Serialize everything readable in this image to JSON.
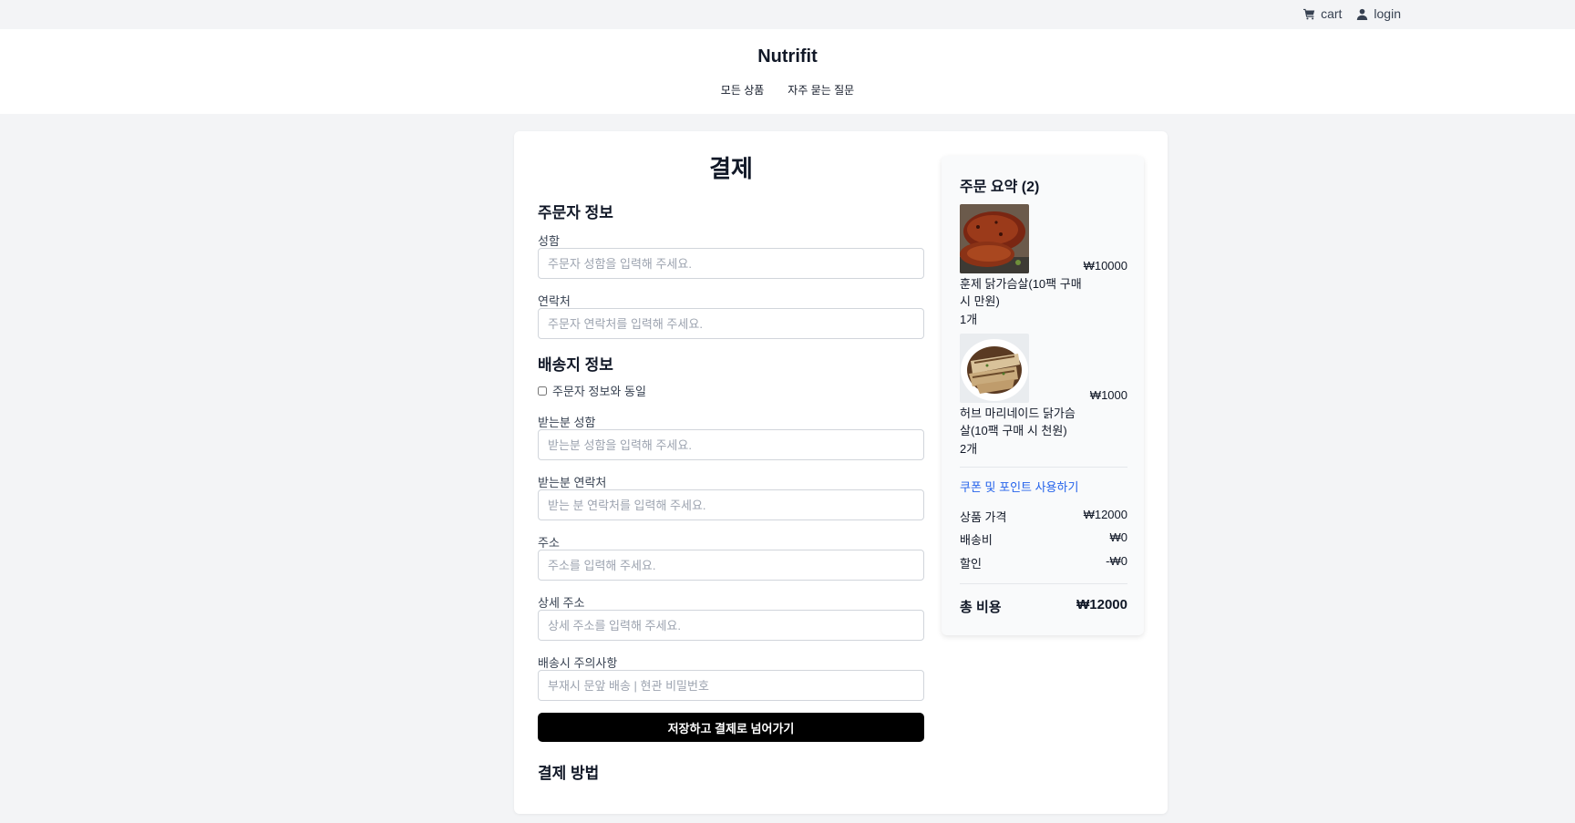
{
  "topbar": {
    "cart_label": "cart",
    "login_label": "login"
  },
  "header": {
    "brand": "Nutrifit",
    "nav": [
      "모든 상품",
      "자주 묻는 질문"
    ]
  },
  "checkout": {
    "title": "결제",
    "orderer_section": "주문자 정보",
    "name_label": "성함",
    "name_placeholder": "주문자 성함을 입력해 주세요.",
    "phone_label": "연락처",
    "phone_placeholder": "주문자 연락처를 입력해 주세요.",
    "shipping_section": "배송지 정보",
    "same_as_orderer_label": "주문자 정보와 동일",
    "recipient_name_label": "받는분 성함",
    "recipient_name_placeholder": "받는분 성함을 입력해 주세요.",
    "recipient_phone_label": "받는분 연락처",
    "recipient_phone_placeholder": "받는 분 연락처를 입력해 주세요.",
    "address_label": "주소",
    "address_placeholder": "주소를 입력해 주세요.",
    "detail_address_label": "상세 주소",
    "detail_address_placeholder": "상세 주소를 입력해 주세요.",
    "delivery_note_label": "배송시 주의사항",
    "delivery_note_placeholder": "부재시 문앞 배송 | 현관 비밀번호",
    "submit_label": "저장하고 결제로 넘어가기",
    "payment_section": "결제 방법"
  },
  "summary": {
    "title": "주문 요약 (2)",
    "items": [
      {
        "name": "훈제 닭가슴살(10팩 구매 시 만원)",
        "qty": "1개",
        "price": "₩10000"
      },
      {
        "name": "허브 마리네이드 닭가슴살(10팩 구매 시 천원)",
        "qty": "2개",
        "price": "₩1000"
      }
    ],
    "coupon_link": "쿠폰 및 포인트 사용하기",
    "subtotal_label": "상품 가격",
    "subtotal_value": "₩12000",
    "shipping_label": "배송비",
    "shipping_value": "₩0",
    "discount_label": "할인",
    "discount_value": "-₩0",
    "total_label": "총 비용",
    "total_value": "₩12000"
  },
  "colors": {
    "accent_link": "#2563eb",
    "primary_button": "#000000",
    "page_background": "#f3f4f6"
  }
}
